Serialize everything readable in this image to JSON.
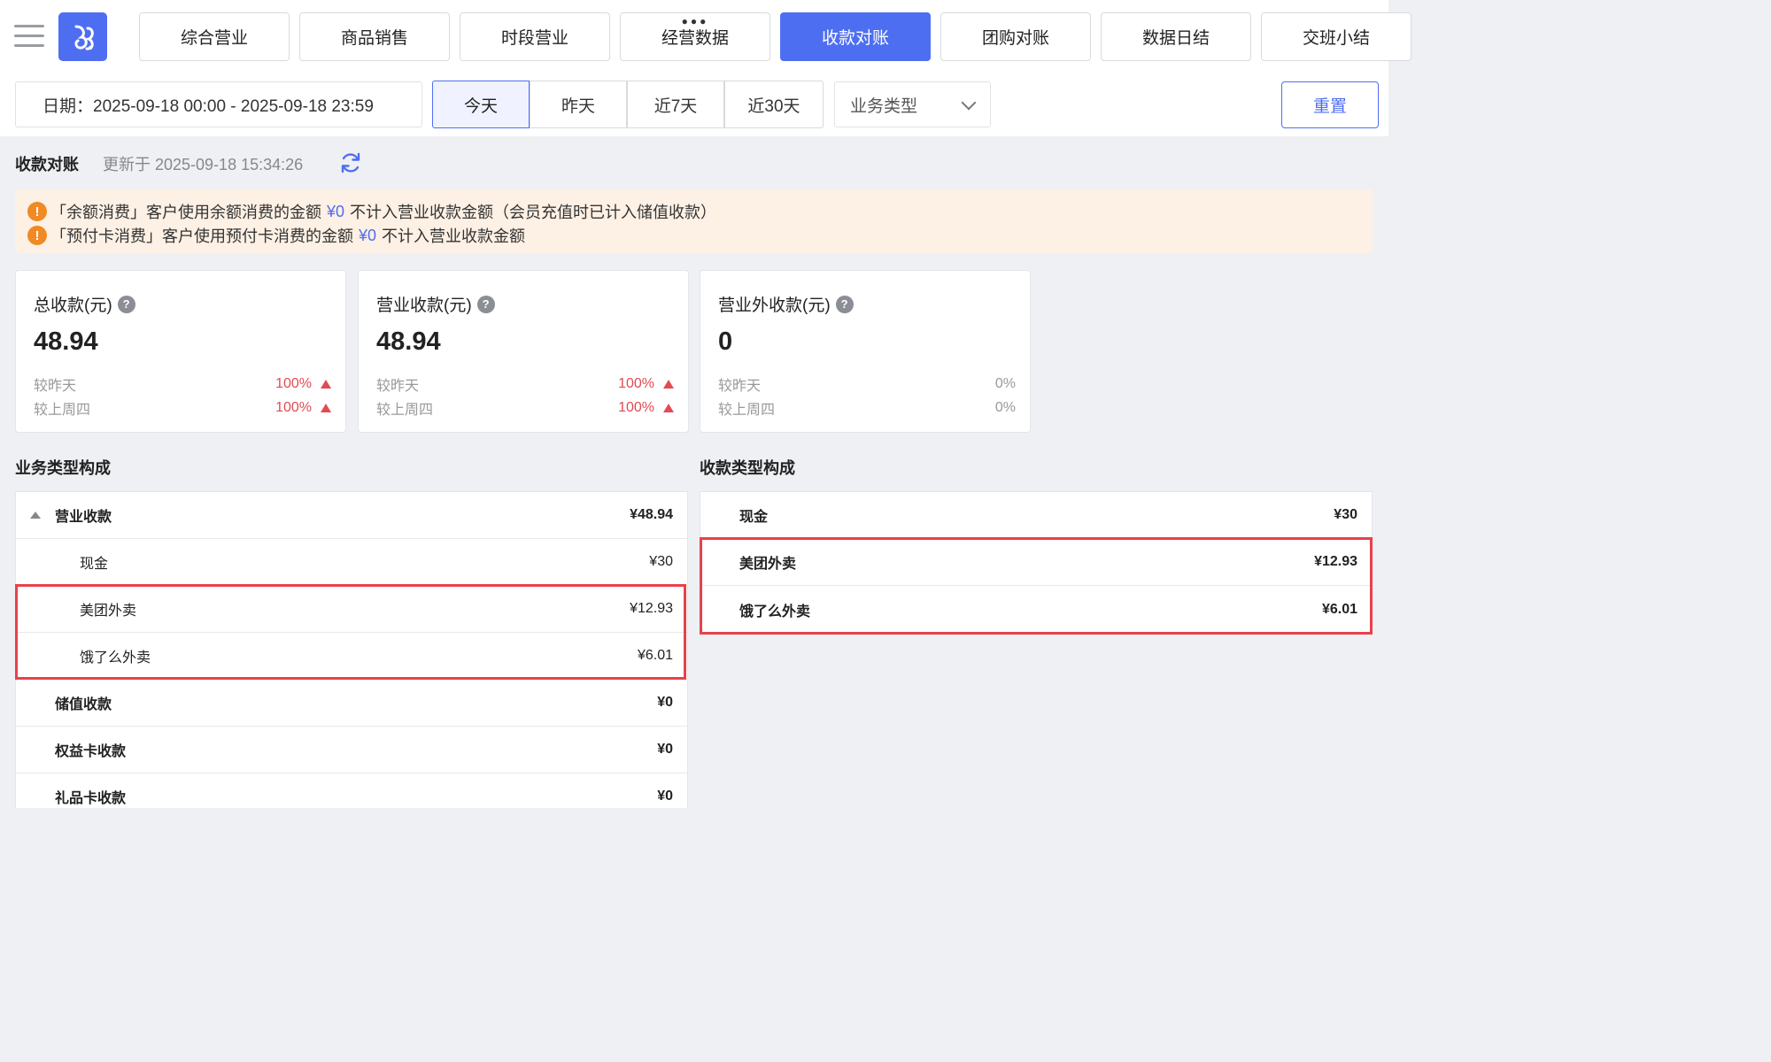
{
  "header": {
    "menu_icon": "hamburger-menu-icon",
    "logo_icon": "brand-logo-icon",
    "tabs": [
      {
        "label": "综合营业",
        "active": false
      },
      {
        "label": "商品销售",
        "active": false
      },
      {
        "label": "时段营业",
        "active": false
      },
      {
        "label": "经营数据",
        "active": false
      },
      {
        "label": "收款对账",
        "active": true
      },
      {
        "label": "团购对账",
        "active": false
      },
      {
        "label": "数据日结",
        "active": false
      },
      {
        "label": "交班小结",
        "active": false
      }
    ]
  },
  "filters": {
    "date_range": "日期：2025-09-18 00:00 - 2025-09-18 23:59",
    "quick_ranges": [
      {
        "label": "今天",
        "active": true
      },
      {
        "label": "昨天",
        "active": false
      },
      {
        "label": "近7天",
        "active": false
      },
      {
        "label": "近30天",
        "active": false
      }
    ],
    "business_type_placeholder": "业务类型",
    "reset_label": "重置"
  },
  "section": {
    "title": "收款对账",
    "updated_at": "更新于 2025-09-18 15:34:26"
  },
  "notices": [
    {
      "prefix": "「余额消费」客户使用余额消费的金额",
      "amount": "¥0",
      "suffix": "不计入营业收款金额（会员充值时已计入储值收款）"
    },
    {
      "prefix": "「预付卡消费」客户使用预付卡消费的金额",
      "amount": "¥0",
      "suffix": "不计入营业收款金额"
    }
  ],
  "cards": [
    {
      "title": "总收款(元)",
      "value": "48.94",
      "vs_yesterday_label": "较昨天",
      "vs_yesterday": "100%",
      "vs_week_label": "较上周四",
      "vs_week": "100%",
      "trend": "up"
    },
    {
      "title": "营业收款(元)",
      "value": "48.94",
      "vs_yesterday_label": "较昨天",
      "vs_yesterday": "100%",
      "vs_week_label": "较上周四",
      "vs_week": "100%",
      "trend": "up"
    },
    {
      "title": "营业外收款(元)",
      "value": "0",
      "vs_yesterday_label": "较昨天",
      "vs_yesterday": "0%",
      "vs_week_label": "较上周四",
      "vs_week": "0%",
      "trend": "flat"
    }
  ],
  "business_composition": {
    "title": "业务类型构成",
    "rows": [
      {
        "label": "营业收款",
        "amount": "¥48.94",
        "level": 0,
        "expandable": true
      },
      {
        "label": "现金",
        "amount": "¥30",
        "level": 1
      },
      {
        "label": "美团外卖",
        "amount": "¥12.93",
        "level": 1
      },
      {
        "label": "饿了么外卖",
        "amount": "¥6.01",
        "level": 1
      },
      {
        "label": "储值收款",
        "amount": "¥0",
        "level": 0
      },
      {
        "label": "权益卡收款",
        "amount": "¥0",
        "level": 0
      },
      {
        "label": "礼品卡收款",
        "amount": "¥0",
        "level": 0
      }
    ]
  },
  "payment_composition": {
    "title": "收款类型构成",
    "rows": [
      {
        "label": "现金",
        "amount": "¥30"
      },
      {
        "label": "美团外卖",
        "amount": "¥12.93"
      },
      {
        "label": "饿了么外卖",
        "amount": "¥6.01"
      }
    ]
  },
  "colors": {
    "accent": "#4e6ef2",
    "up": "#e24a54",
    "warning": "#f08a24",
    "highlight": "#e8414a"
  }
}
